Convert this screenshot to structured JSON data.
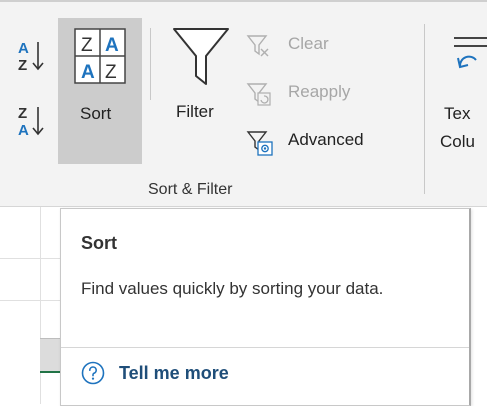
{
  "ribbon": {
    "sort_label": "Sort",
    "filter_label": "Filter",
    "clear_label": "Clear",
    "reapply_label": "Reapply",
    "advanced_label": "Advanced",
    "text_to_columns_line1": "Tex",
    "text_to_columns_line2": "Colu",
    "group_label": "Sort & Filter"
  },
  "tooltip": {
    "title": "Sort",
    "description": "Find values quickly by sorting your data.",
    "link_text": "Tell me more"
  },
  "colors": {
    "accent_blue": "#1e73be",
    "link_blue": "#1f4e79",
    "selected_bg": "#cccccc",
    "grid_green": "#217346"
  }
}
